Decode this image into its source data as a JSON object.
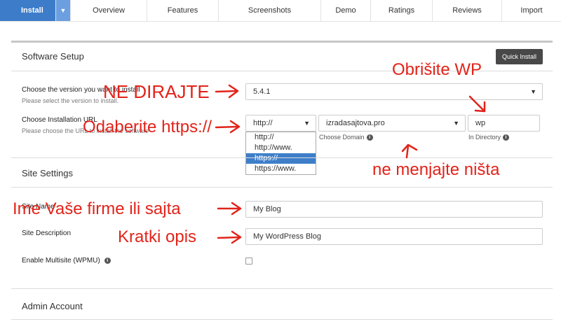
{
  "tabs": {
    "install": "Install",
    "items": [
      "Overview",
      "Features",
      "Screenshots",
      "Demo",
      "Ratings",
      "Reviews",
      "Import"
    ]
  },
  "software_setup": {
    "title": "Software Setup",
    "quick_install": "Quick Install",
    "version_label": "Choose the version you want to install",
    "version_help": "Please select the version to install.",
    "version_value": "5.4.1",
    "url_label": "Choose Installation URL",
    "url_help": "Please choose the URL to install the software",
    "protocol_value": "http://",
    "protocol_options": [
      "http://",
      "http://www.",
      "https://",
      "https://www."
    ],
    "protocol_selected_index": 2,
    "domain_value": "izradasajtova.pro",
    "domain_caption": "Choose Domain",
    "directory_value": "wp",
    "directory_caption": "In Directory"
  },
  "site_settings": {
    "title": "Site Settings",
    "site_name_label": "Site Name",
    "site_name_value": "My Blog",
    "site_desc_label": "Site Description",
    "site_desc_value": "My WordPress Blog",
    "multisite_label": "Enable Multisite (WPMU)"
  },
  "admin": {
    "title": "Admin Account"
  },
  "annotations": {
    "ne_dirajte": "NE DIRAJTE",
    "obrisite": "Obrišite WP",
    "odaberite": "Odaberite https://",
    "ne_menjajte": "ne menjajte ništa",
    "ime": "Ime Vaše firme ili sajta",
    "kratki": "Kratki opis"
  },
  "colors": {
    "accent": "#3d7cc9",
    "annotation": "#e2231a",
    "selected_option": "#3e7ec9"
  }
}
